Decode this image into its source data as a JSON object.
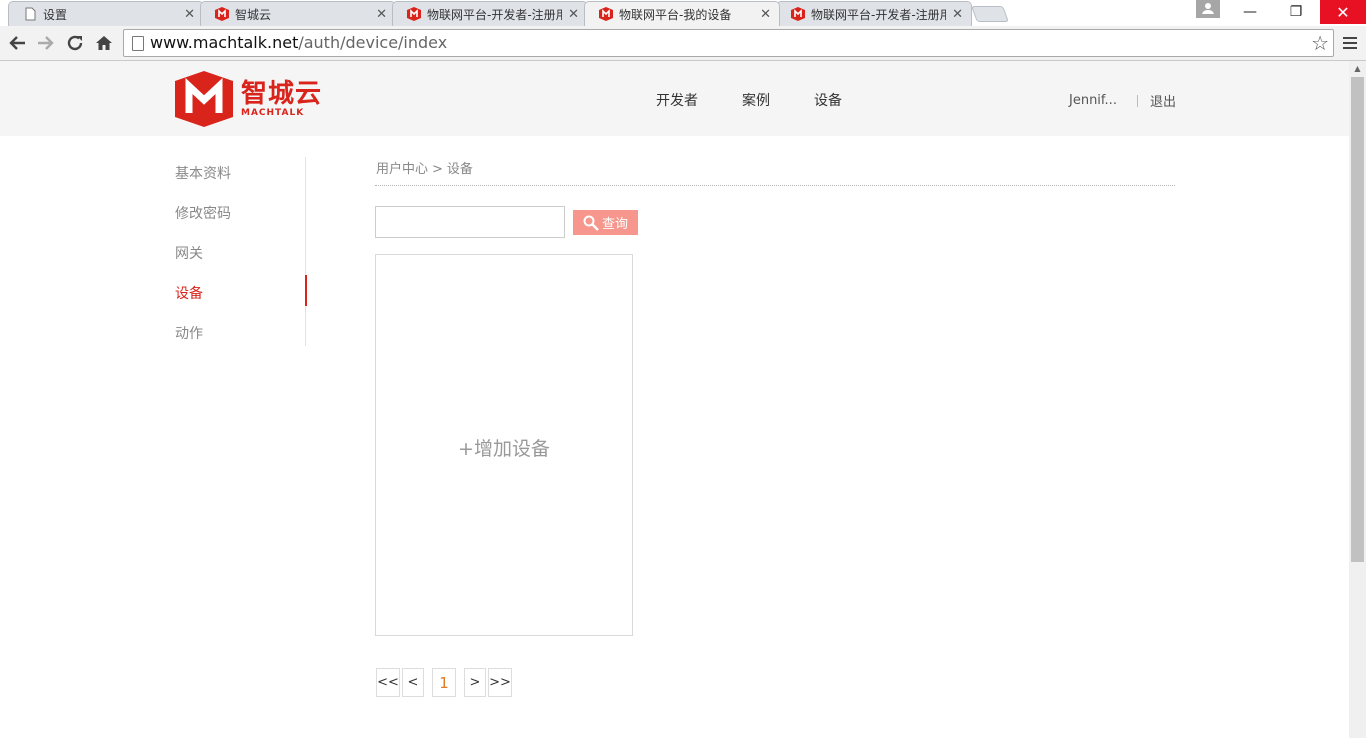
{
  "browser": {
    "tabs": [
      {
        "title": "设置",
        "active": false
      },
      {
        "title": "智城云",
        "active": false
      },
      {
        "title": "物联网平台-开发者-注册用",
        "active": false
      },
      {
        "title": "物联网平台-我的设备",
        "active": true
      },
      {
        "title": "物联网平台-开发者-注册用",
        "active": false
      }
    ],
    "url_host": "www.machtalk.net",
    "url_path": "/auth/device/index",
    "window_controls": {
      "minimize": "—",
      "maximize": "❐",
      "close": "✕"
    }
  },
  "header": {
    "logo_cn": "智城云",
    "logo_en": "MACHTALK",
    "nav": [
      {
        "label": "开发者"
      },
      {
        "label": "案例"
      },
      {
        "label": "设备"
      }
    ],
    "user_name": "Jennif...",
    "logout_label": "退出"
  },
  "sidebar": {
    "items": [
      {
        "label": "基本资料",
        "active": false
      },
      {
        "label": "修改密码",
        "active": false
      },
      {
        "label": "网关",
        "active": false
      },
      {
        "label": "设备",
        "active": true
      },
      {
        "label": "动作",
        "active": false
      }
    ]
  },
  "main": {
    "breadcrumb": {
      "parent": "用户中心",
      "separator": ">",
      "current": "设备"
    },
    "search": {
      "value": "",
      "placeholder": "",
      "button_label": "查询"
    },
    "add_device_label": "+增加设备",
    "pagination": {
      "first": "<<",
      "prev": "<",
      "current": "1",
      "next": ">",
      "last": ">>"
    }
  },
  "colors": {
    "brand_red": "#d9241c",
    "search_button": "#f6968c",
    "current_page": "#e07b26"
  }
}
